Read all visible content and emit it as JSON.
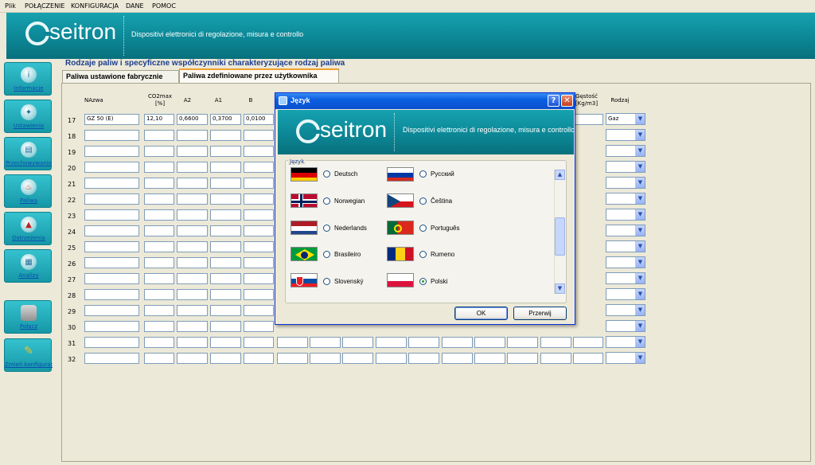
{
  "menu": [
    "Plik",
    "POŁĄCZENIE",
    "KONFIGURACJA",
    "DANE",
    "POMOC"
  ],
  "brand": {
    "logo": "seitron",
    "tagline": "Dispositivi elettronici di regolazione, misura e controllo",
    "color": "#0c8796"
  },
  "sidebar": [
    {
      "label": "Informacje",
      "icon": "info-icon"
    },
    {
      "label": "Ustawienia",
      "icon": "settings-icon"
    },
    {
      "label": "Przechowywanie",
      "icon": "storage-icon"
    },
    {
      "label": "Paliwa",
      "icon": "flame-icon"
    },
    {
      "label": "Ostrzeżenia",
      "icon": "warning-icon"
    },
    {
      "label": "Analizy",
      "icon": "analysis-icon"
    },
    {
      "label": "Połącz",
      "icon": "connect-icon"
    },
    {
      "label": "Zmień konfigurację",
      "icon": "pencil-icon"
    }
  ],
  "page": {
    "heading": "Rodzaje paliw i specyficzne współczynniki charakteryzujące rodzaj paliwa",
    "tabs": [
      "Paliwa ustawione fabrycznie",
      "Paliwa zdefiniowane przez użytkownika"
    ]
  },
  "grid": {
    "headers": {
      "name": "NAzwa",
      "co2max": "CO2max [%]",
      "a2": "A2",
      "a1": "A1",
      "b": "B",
      "density": "Gęstość [Kg/m3]",
      "kind": "Rodzaj"
    },
    "first_row": {
      "num": "17",
      "name": "GZ 50 (E)",
      "co2max": "12,10",
      "a2": "0,6600",
      "a1": "0,3700",
      "b": "0,0100",
      "kind": "Gaz"
    },
    "row_numbers": [
      "18",
      "19",
      "20",
      "21",
      "22",
      "23",
      "24",
      "25",
      "26",
      "27",
      "28",
      "29",
      "30",
      "31",
      "32"
    ]
  },
  "dialog": {
    "title": "Język",
    "group_label": "Język",
    "help_label": "?",
    "close_label": "✕",
    "languages": [
      {
        "name": "Deutsch",
        "flag": "germany-flag"
      },
      {
        "name": "Русский",
        "flag": "russia-flag"
      },
      {
        "name": "Norwegian",
        "flag": "norway-flag"
      },
      {
        "name": "Čeština",
        "flag": "czech-flag"
      },
      {
        "name": "Nederlands",
        "flag": "netherlands-flag"
      },
      {
        "name": "Português",
        "flag": "portugal-flag"
      },
      {
        "name": "Brasileiro",
        "flag": "brazil-flag"
      },
      {
        "name": "Rumeno",
        "flag": "romania-flag"
      },
      {
        "name": "Slovenský",
        "flag": "slovakia-flag"
      },
      {
        "name": "Polski",
        "flag": "poland-flag"
      }
    ],
    "selected": "Polski",
    "ok": "OK",
    "cancel": "Przerwij"
  }
}
